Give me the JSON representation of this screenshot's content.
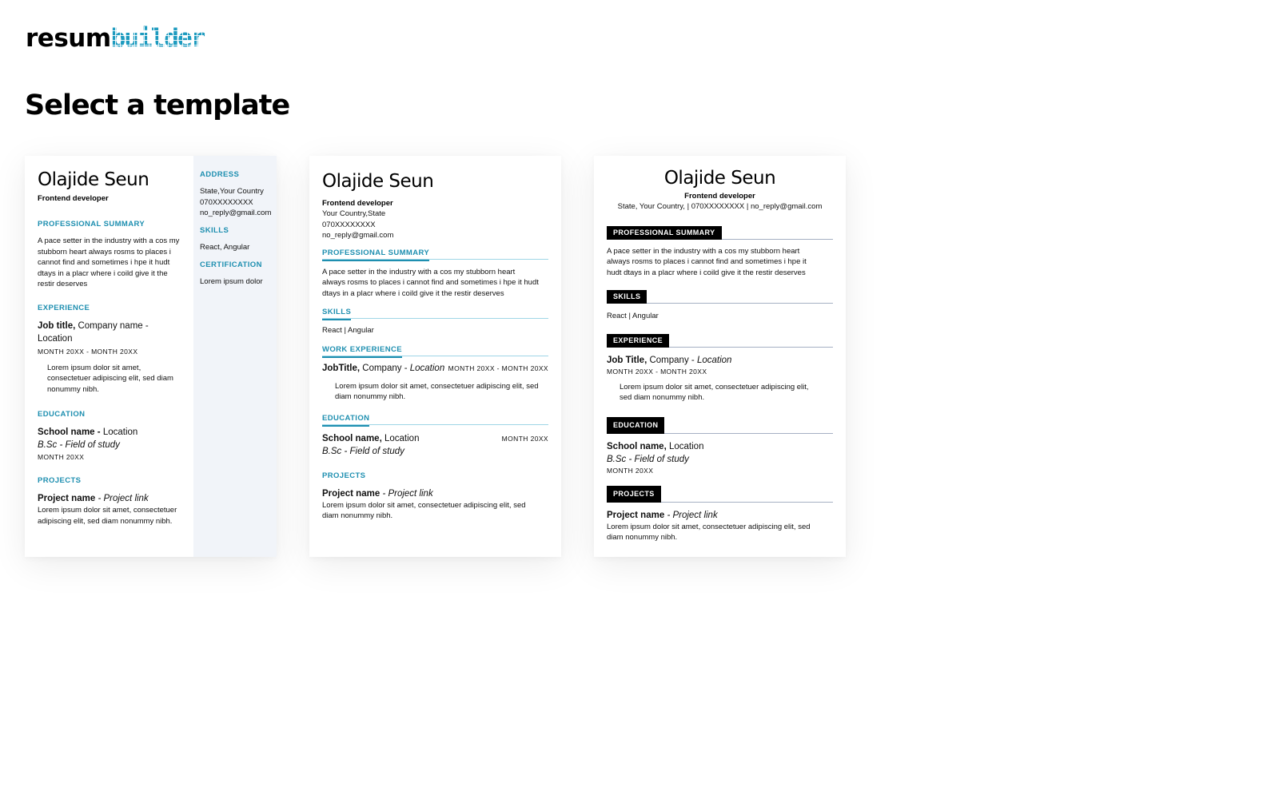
{
  "brand": {
    "logo_dark": "resum",
    "logo_accent": "builder"
  },
  "page": {
    "title": "Select a template"
  },
  "templates": [
    {
      "name": "Olajide Seun",
      "role": "Frontend developer",
      "summary_heading": "PROFESSIONAL SUMMARY",
      "summary": "A pace setter in the industry with a cos my stubborn heart always rosms to places i cannot find and sometimes i hpe it hudt dtays in a placr where i coild give it the restir deserves",
      "experience_heading": "EXPERIENCE",
      "job_title": "Job title,",
      "job_company": "Company name",
      "job_location": "- Location",
      "job_dates": "MONTH 20XX - MONTH 20XX",
      "job_desc": "Lorem ipsum dolor sit amet, consectetuer adipiscing elit, sed diam nonummy nibh.",
      "education_heading": "EDUCATION",
      "school": "School name -",
      "school_location": "Location",
      "degree": "B.Sc - Field of study",
      "edu_date": "MONTH 20XX",
      "projects_heading": "PROJECTS",
      "project_name": "Project name",
      "project_link": "- Project link",
      "project_desc": "Lorem ipsum dolor sit amet, consectetuer adipiscing elit, sed diam nonummy nibh.",
      "address_heading": "ADDRESS",
      "address": "State,Your Country",
      "phone": "070XXXXXXXX",
      "email": "no_reply@gmail.com",
      "skills_heading": "SKILLS",
      "skills": "React, Angular",
      "cert_heading": "CERTIFICATION",
      "cert": "Lorem ipsum dolor"
    },
    {
      "name": "Olajide Seun",
      "role": "Frontend developer",
      "address": "Your Country,State",
      "phone": "070XXXXXXXX",
      "email": "no_reply@gmail.com",
      "summary_heading": "PROFESSIONAL SUMMARY",
      "summary": "A pace setter in the industry with a cos my stubborn heart always rosms to places i cannot find and sometimes i hpe it hudt dtays in a placr where i coild give it the restir deserves",
      "skills_heading": "SKILLS",
      "skills": "React | Angular",
      "experience_heading": "WORK EXPERIENCE",
      "job_title": "JobTitle,",
      "job_company": "Company -",
      "job_location": "Location",
      "job_dates": "MONTH 20XX - MONTH 20XX",
      "job_desc": "Lorem ipsum dolor sit amet, consectetuer adipiscing elit, sed diam nonummy nibh.",
      "education_heading": "EDUCATION",
      "school": "School name,",
      "school_location": "Location",
      "edu_date": "MONTH 20XX",
      "degree": "B.Sc - Field of study",
      "projects_heading": "PROJECTS",
      "project_name": "Project name",
      "project_link": "- Project link",
      "project_desc": "Lorem ipsum dolor sit amet, consectetuer adipiscing elit, sed diam nonummy nibh."
    },
    {
      "name": "Olajide Seun",
      "role": "Frontend developer",
      "contact": "State, Your Country, | 070XXXXXXXX | no_reply@gmail.com",
      "summary_heading": "PROFESSIONAL SUMMARY",
      "summary": "A pace setter in the industry with a cos my stubborn heart always rosms to places i cannot find and sometimes i hpe it hudt dtays in a placr where i coild give it the restir deserves",
      "skills_heading": "SKILLS",
      "skills": "React | Angular",
      "experience_heading": "EXPERIENCE",
      "job_title": "Job Title,",
      "job_company": "Company -",
      "job_location": "Location",
      "job_dates": "MONTH 20XX - MONTH 20XX",
      "job_desc": "Lorem ipsum dolor sit amet, consectetuer adipiscing elit, sed diam nonummy nibh.",
      "education_heading": "EDUCATION",
      "school": "School name,",
      "school_location": "Location",
      "degree": "B.Sc - Field of study",
      "edu_date": "MONTH 20XX",
      "projects_heading": "PROJECTS",
      "project_name": "Project name",
      "project_link": "- Project link",
      "project_desc": "Lorem ipsum dolor sit amet, consectetuer adipiscing elit, sed diam nonummy nibh."
    }
  ]
}
